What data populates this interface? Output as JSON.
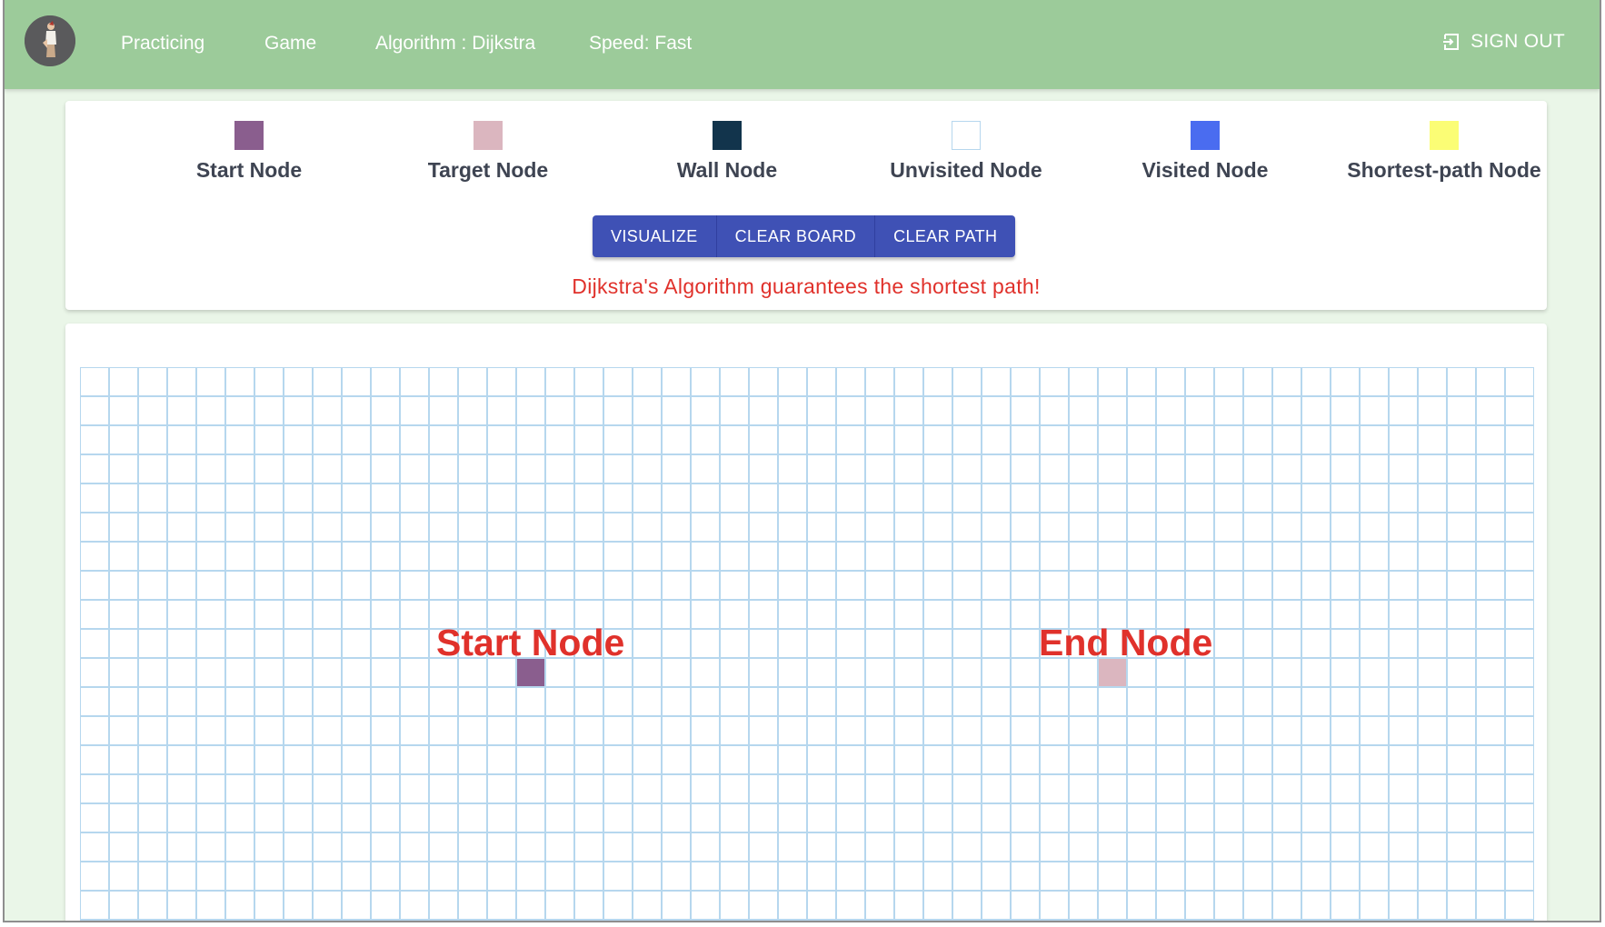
{
  "navbar": {
    "practicing": "Practicing",
    "game": "Game",
    "algorithm": "Algorithm : Dijkstra",
    "speed": "Speed: Fast",
    "sign_out": "SIGN OUT"
  },
  "legend": [
    {
      "label": "Start Node",
      "color": "#8a5e8e"
    },
    {
      "label": "Target Node",
      "color": "#dbb6bf"
    },
    {
      "label": "Wall Node",
      "color": "#12344c"
    },
    {
      "label": "Unvisited Node",
      "color": "#ffffff"
    },
    {
      "label": "Visited Node",
      "color": "#4a6cf0"
    },
    {
      "label": "Shortest-path Node",
      "color": "#fbfd75"
    }
  ],
  "controls": {
    "visualize": "VISUALIZE",
    "clear_board": "CLEAR BOARD",
    "clear_path": "CLEAR PATH"
  },
  "message": "Dijkstra's Algorithm guarantees the shortest path!",
  "board": {
    "start_caption": "Start Node",
    "end_caption": "End Node",
    "start_cell": {
      "row": 10,
      "col": 15
    },
    "target_cell": {
      "row": 10,
      "col": 35
    }
  },
  "colors": {
    "navbar": "#9ccb9a",
    "accent_button": "#3f51b5",
    "message": "#e0312b"
  }
}
